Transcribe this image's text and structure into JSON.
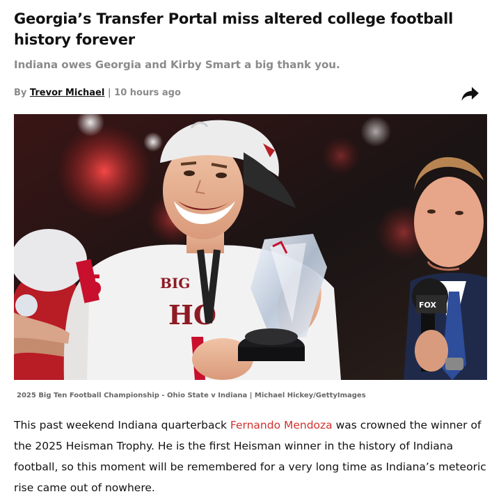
{
  "article": {
    "headline": "Georgia’s Transfer Portal miss altered college football history forever",
    "subheadline": "Indiana owes Georgia and Kirby Smart a big thank you.",
    "byline": {
      "prefix": "By",
      "author": "Trevor Michael",
      "separator": "|",
      "time": "10 hours ago"
    },
    "share_icon": "share-arrow-icon",
    "image": {
      "caption": "2025 Big Ten Football Championship - Ohio State v Indiana | Michael Hickey/GettyImages",
      "jersey_logo": "BIG",
      "jersey_text": "HO",
      "jersey_number": "5",
      "mic_flag": "FOX"
    },
    "body": {
      "p1_before": "This past weekend Indiana quarterback ",
      "p1_link": "Fernando Mendoza",
      "p1_after": " was crowned the winner of the 2025 Heisman Trophy. He is the first Heisman winner in the history of Indiana football, so this moment will be remembered for a very long time as Indiana’s meteoric rise came out of nowhere."
    }
  },
  "colors": {
    "link": "#d0312d",
    "muted": "#8a8a8a",
    "text": "#111111"
  }
}
